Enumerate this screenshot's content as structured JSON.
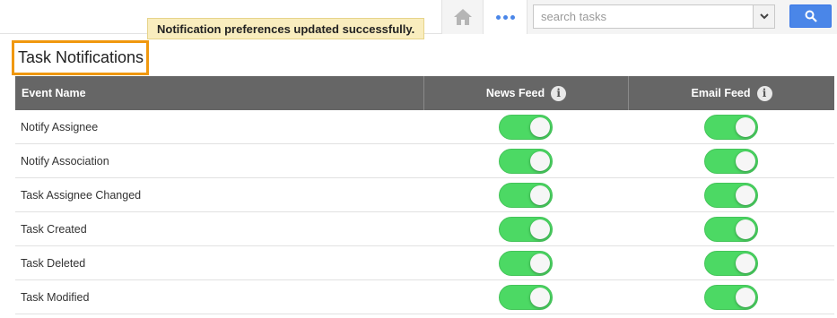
{
  "topbar": {
    "home_icon": "home-icon",
    "more_icon": "more-dots-icon",
    "search": {
      "value": "",
      "placeholder": "search tasks"
    },
    "search_button_icon": "search-icon",
    "accent_color": "#4a86e8"
  },
  "toast": {
    "message": "Notification preferences updated successfully."
  },
  "page": {
    "title": "Task Notifications"
  },
  "table": {
    "headers": {
      "event": "Event Name",
      "news": "News Feed",
      "email": "Email Feed"
    },
    "info_icon_glyph": "i",
    "toggle_color": "#4cd964",
    "rows": [
      {
        "event": "Notify Assignee",
        "news_feed": true,
        "email_feed": true
      },
      {
        "event": "Notify Association",
        "news_feed": true,
        "email_feed": true
      },
      {
        "event": "Task Assignee Changed",
        "news_feed": true,
        "email_feed": true
      },
      {
        "event": "Task Created",
        "news_feed": true,
        "email_feed": true
      },
      {
        "event": "Task Deleted",
        "news_feed": true,
        "email_feed": true
      },
      {
        "event": "Task Modified",
        "news_feed": true,
        "email_feed": true
      }
    ]
  }
}
